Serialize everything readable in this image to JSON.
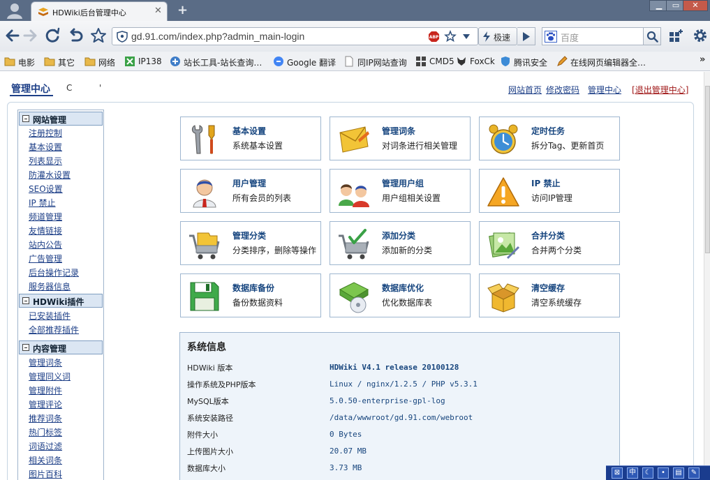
{
  "browser": {
    "tab_title": "HDWiki后台管理中心",
    "tab_close": "✕",
    "new_tab": "+",
    "url": "gd.91.com/index.php?admin_main-login",
    "speed_label": "极速",
    "search_placeholder": "百度",
    "bookmarks": [
      "电影",
      "其它",
      "网络",
      "IP138",
      "站长工具-站长查询…",
      "Google 翻译",
      "同IP网站查询",
      "CMD5",
      "FoxCk",
      "腾讯安全",
      "在线网页编辑器全…"
    ],
    "bookmarks_more": "»",
    "win_min": "▁",
    "win_max": "▭",
    "win_close": "✕"
  },
  "header": {
    "title": "管理中心",
    "user_a": "C",
    "user_b": "'",
    "links": [
      "网站首页",
      "修改密码",
      "管理中心"
    ],
    "logout_open": "[",
    "logout": "退出管理中心",
    "logout_close": "]"
  },
  "sidebar": {
    "groups": [
      {
        "title": "网站管理",
        "items": [
          "注册控制",
          "基本设置",
          "列表显示",
          "防灌水设置",
          "SEO设置",
          "IP 禁止",
          "频道管理",
          "友情链接",
          "站内公告",
          "广告管理",
          "后台操作记录",
          "服务器信息"
        ]
      },
      {
        "title": "HDWiki插件",
        "items": [
          "已安装插件",
          "全部推荐插件"
        ]
      },
      {
        "title": "内容管理",
        "items": [
          "管理词条",
          "管理同义词",
          "管理附件",
          "管理评论",
          "推荐词条",
          "热门标签",
          "词语过滤",
          "相关词条",
          "图片百科"
        ]
      }
    ]
  },
  "cards": [
    {
      "title": "基本设置",
      "desc": "系统基本设置",
      "icon": "tools-icon"
    },
    {
      "title": "管理词条",
      "desc": "对词条进行相关管理",
      "icon": "envelope-icon"
    },
    {
      "title": "定时任务",
      "desc": "拆分Tag、更新首页",
      "icon": "alarm-clock-icon"
    },
    {
      "title": "用户管理",
      "desc": "所有会员的列表",
      "icon": "user-icon"
    },
    {
      "title": "管理用户组",
      "desc": "用户组相关设置",
      "icon": "user-group-icon"
    },
    {
      "title": "IP 禁止",
      "desc": "访问IP管理",
      "icon": "warning-icon"
    },
    {
      "title": "管理分类",
      "desc": "分类排序，删除等操作",
      "icon": "cart-folder-icon"
    },
    {
      "title": "添加分类",
      "desc": "添加新的分类",
      "icon": "cart-add-icon"
    },
    {
      "title": "合并分类",
      "desc": "合并两个分类",
      "icon": "merge-image-icon"
    },
    {
      "title": "数据库备份",
      "desc": "备份数据资料",
      "icon": "floppy-disk-icon"
    },
    {
      "title": "数据库优化",
      "desc": "优化数据库表",
      "icon": "disc-optimize-icon"
    },
    {
      "title": "清空缓存",
      "desc": "清空系统缓存",
      "icon": "open-box-icon"
    }
  ],
  "sysinfo": {
    "title": "系统信息",
    "rows": [
      {
        "label": "HDWiki 版本",
        "value": "HDWiki V4.1 release 20100128"
      },
      {
        "label": "操作系统及PHP版本",
        "value": "Linux / nginx/1.2.5 / PHP v5.3.1"
      },
      {
        "label": "MySQL版本",
        "value": "5.0.50-enterprise-gpl-log"
      },
      {
        "label": "系统安装路径",
        "value": "/data/wwwroot/gd.91.com/webroot"
      },
      {
        "label": "附件大小",
        "value": "0 Bytes"
      },
      {
        "label": "上传图片大小",
        "value": "20.07 MB"
      },
      {
        "label": "数据库大小",
        "value": "3.73 MB"
      }
    ]
  },
  "taskbar": {
    "ime_label": "中"
  },
  "colors": {
    "link": "#1d3f87",
    "card_title": "#16457f",
    "sysinfo_bg": "#eef4fa",
    "logout": "#a01818"
  }
}
